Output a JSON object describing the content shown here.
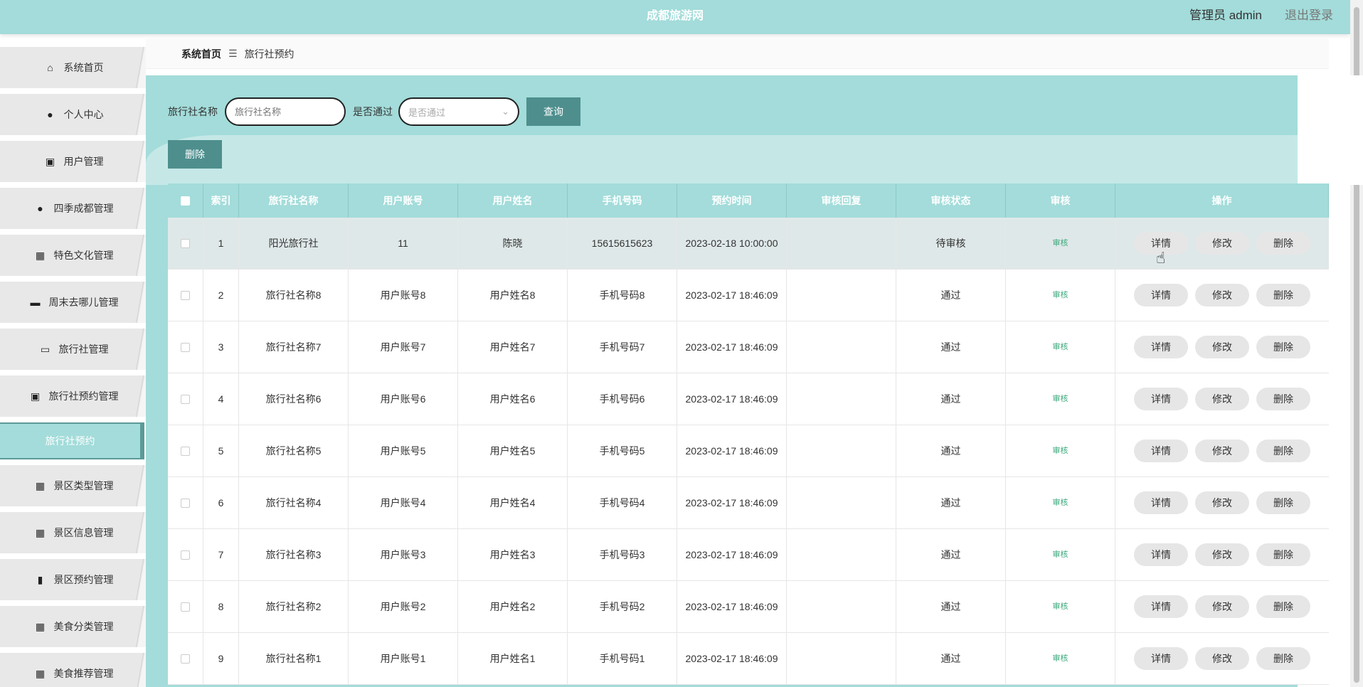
{
  "header": {
    "title": "成都旅游网",
    "user": "管理员 admin",
    "logout": "退出登录"
  },
  "sidebar": {
    "items": [
      {
        "label": "系统首页",
        "icon": "home-icon",
        "glyph": "⌂"
      },
      {
        "label": "个人中心",
        "icon": "person-icon",
        "glyph": "●"
      },
      {
        "label": "用户管理",
        "icon": "clipboard-icon",
        "glyph": "▣"
      },
      {
        "label": "四季成都管理",
        "icon": "person-icon",
        "glyph": "●"
      },
      {
        "label": "特色文化管理",
        "icon": "grid-icon",
        "glyph": "▦"
      },
      {
        "label": "周末去哪儿管理",
        "icon": "briefcase-icon",
        "glyph": "▬"
      },
      {
        "label": "旅行社管理",
        "icon": "laptop-icon",
        "glyph": "▭"
      },
      {
        "label": "旅行社预约管理",
        "icon": "clipboard-icon",
        "glyph": "▣"
      }
    ],
    "sub_active": "旅行社预约",
    "items2": [
      {
        "label": "景区类型管理",
        "icon": "grid-icon",
        "glyph": "▦"
      },
      {
        "label": "景区信息管理",
        "icon": "grid-icon",
        "glyph": "▦"
      },
      {
        "label": "景区预约管理",
        "icon": "bar-chart-icon",
        "glyph": "▮"
      },
      {
        "label": "美食分类管理",
        "icon": "grid-icon",
        "glyph": "▦"
      },
      {
        "label": "美食推荐管理",
        "icon": "grid-icon",
        "glyph": "▦"
      }
    ]
  },
  "breadcrumb": {
    "home": "系统首页",
    "sep": "☰",
    "current": "旅行社预约"
  },
  "search": {
    "name_label": "旅行社名称",
    "name_placeholder": "旅行社名称",
    "pass_label": "是否通过",
    "pass_placeholder": "是否通过",
    "query_button": "查询",
    "delete_button": "删除"
  },
  "table": {
    "headers": [
      "",
      "索引",
      "旅行社名称",
      "用户账号",
      "用户姓名",
      "手机号码",
      "预约时间",
      "审核回复",
      "审核状态",
      "审核",
      "操作"
    ],
    "rows": [
      {
        "index": "1",
        "agency": "阳光旅行社",
        "account": "11",
        "name": "陈晓",
        "phone": "15615615623",
        "time": "2023-02-18 10:00:00",
        "reply": "",
        "status": "待审核",
        "audit": "审核"
      },
      {
        "index": "2",
        "agency": "旅行社名称8",
        "account": "用户账号8",
        "name": "用户姓名8",
        "phone": "手机号码8",
        "time": "2023-02-17 18:46:09",
        "reply": "",
        "status": "通过",
        "audit": "审核"
      },
      {
        "index": "3",
        "agency": "旅行社名称7",
        "account": "用户账号7",
        "name": "用户姓名7",
        "phone": "手机号码7",
        "time": "2023-02-17 18:46:09",
        "reply": "",
        "status": "通过",
        "audit": "审核"
      },
      {
        "index": "4",
        "agency": "旅行社名称6",
        "account": "用户账号6",
        "name": "用户姓名6",
        "phone": "手机号码6",
        "time": "2023-02-17 18:46:09",
        "reply": "",
        "status": "通过",
        "audit": "审核"
      },
      {
        "index": "5",
        "agency": "旅行社名称5",
        "account": "用户账号5",
        "name": "用户姓名5",
        "phone": "手机号码5",
        "time": "2023-02-17 18:46:09",
        "reply": "",
        "status": "通过",
        "audit": "审核"
      },
      {
        "index": "6",
        "agency": "旅行社名称4",
        "account": "用户账号4",
        "name": "用户姓名4",
        "phone": "手机号码4",
        "time": "2023-02-17 18:46:09",
        "reply": "",
        "status": "通过",
        "audit": "审核"
      },
      {
        "index": "7",
        "agency": "旅行社名称3",
        "account": "用户账号3",
        "name": "用户姓名3",
        "phone": "手机号码3",
        "time": "2023-02-17 18:46:09",
        "reply": "",
        "status": "通过",
        "audit": "审核"
      },
      {
        "index": "8",
        "agency": "旅行社名称2",
        "account": "用户账号2",
        "name": "用户姓名2",
        "phone": "手机号码2",
        "time": "2023-02-17 18:46:09",
        "reply": "",
        "status": "通过",
        "audit": "审核"
      },
      {
        "index": "9",
        "agency": "旅行社名称1",
        "account": "用户账号1",
        "name": "用户姓名1",
        "phone": "手机号码1",
        "time": "2023-02-17 18:46:09",
        "reply": "",
        "status": "通过",
        "audit": "审核"
      }
    ],
    "actions": {
      "detail": "详情",
      "edit": "修改",
      "delete": "删除"
    }
  },
  "colors": {
    "accent": "#a3dcda",
    "button": "#4e8f8e",
    "audit_link": "#3aa87b"
  }
}
